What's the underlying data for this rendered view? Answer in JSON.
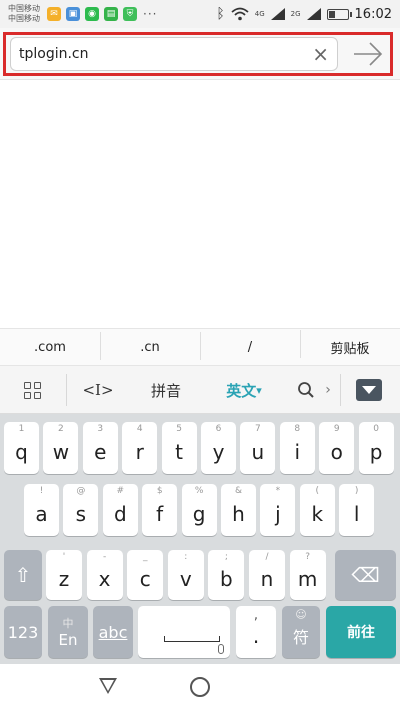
{
  "status_bar": {
    "carrier_line1": "中国移动",
    "carrier_line2": "中国移动",
    "more": "···",
    "net1": "4G",
    "net2": "2G",
    "time": "16:02"
  },
  "url_bar": {
    "value": "tplogin.cn",
    "clear_glyph": "×"
  },
  "suggestions": [
    ".com",
    ".cn",
    "/",
    "剪贴板"
  ],
  "ime_bar": {
    "cursor_label": "<I>",
    "pinyin_label": "拼音",
    "english_label": "英文",
    "english_caret": "▾",
    "search_glyph": "⚲",
    "more_glyph": "›"
  },
  "keyboard": {
    "row1": [
      {
        "main": "q",
        "hint": "1"
      },
      {
        "main": "w",
        "hint": "2"
      },
      {
        "main": "e",
        "hint": "3"
      },
      {
        "main": "r",
        "hint": "4"
      },
      {
        "main": "t",
        "hint": "5"
      },
      {
        "main": "y",
        "hint": "6"
      },
      {
        "main": "u",
        "hint": "7"
      },
      {
        "main": "i",
        "hint": "8"
      },
      {
        "main": "o",
        "hint": "9"
      },
      {
        "main": "p",
        "hint": "0"
      }
    ],
    "row2": [
      {
        "main": "a",
        "hint": "!"
      },
      {
        "main": "s",
        "hint": "@"
      },
      {
        "main": "d",
        "hint": "#"
      },
      {
        "main": "f",
        "hint": "$"
      },
      {
        "main": "g",
        "hint": "%"
      },
      {
        "main": "h",
        "hint": "&"
      },
      {
        "main": "j",
        "hint": "*"
      },
      {
        "main": "k",
        "hint": "("
      },
      {
        "main": "l",
        "hint": ")"
      }
    ],
    "row3": [
      {
        "main": "z",
        "hint": "'"
      },
      {
        "main": "x",
        "hint": "-"
      },
      {
        "main": "c",
        "hint": "_"
      },
      {
        "main": "v",
        "hint": ":"
      },
      {
        "main": "b",
        "hint": ";"
      },
      {
        "main": "n",
        "hint": "/"
      },
      {
        "main": "m",
        "hint": "?"
      }
    ],
    "shift_glyph": "⇧",
    "delete_glyph": "⌫",
    "num_label": "123",
    "cn_en_top": "中",
    "cn_en_bottom": "En",
    "abc_label": "abc",
    "comma_hint": ",",
    "period_label": ".",
    "symbol_hint": "☺",
    "symbol_label": "符",
    "enter_label": "前往"
  }
}
